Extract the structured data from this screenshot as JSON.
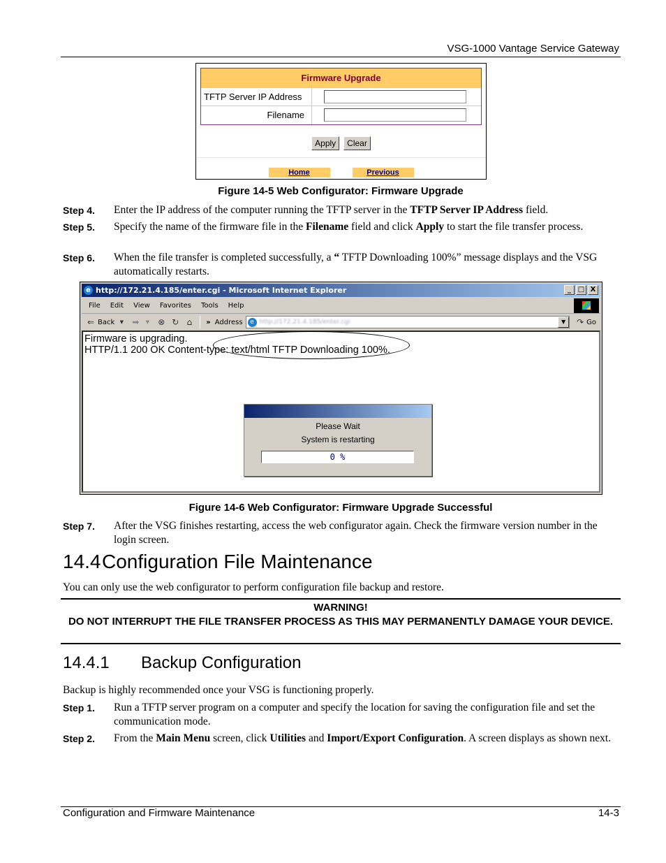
{
  "header": {
    "title": "VSG-1000 Vantage Service Gateway"
  },
  "figure5": {
    "caption": "Figure 14-5 Web Configurator: Firmware Upgrade",
    "form": {
      "title": "Firmware Upgrade",
      "fields": [
        {
          "label": "TFTP Server IP Address",
          "value": ""
        },
        {
          "label": "Filename",
          "value": ""
        }
      ],
      "buttons": {
        "apply": "Apply",
        "clear": "Clear"
      },
      "nav": {
        "home": "Home",
        "previous": "Previous"
      }
    },
    "colors": {
      "header_bg": "#ffcc66",
      "header_text": "#800040",
      "border": "#7a3a7a"
    }
  },
  "steps_a": [
    {
      "num": "Step 4.",
      "parts": [
        {
          "t": "Enter the IP address of the computer running the TFTP server in the "
        },
        {
          "t": "TFTP Server IP Address",
          "b": true
        },
        {
          "t": " field."
        }
      ]
    },
    {
      "num": "Step 5.",
      "parts": [
        {
          "t": "Specify the name of the firmware file in the "
        },
        {
          "t": "Filename",
          "b": true
        },
        {
          "t": " field and click "
        },
        {
          "t": "Apply",
          "b": true
        },
        {
          "t": " to start the file transfer process."
        }
      ]
    },
    {
      "num": "Step 6.",
      "parts": [
        {
          "t": "When the file transfer is completed successfully, a "
        },
        {
          "t": "“",
          "b": true
        },
        {
          "t": " TFTP Downloading 100%” message displays and the VSG automatically restarts."
        }
      ]
    }
  ],
  "figure6": {
    "caption": "Figure 14-6 Web Configurator: Firmware Upgrade Successful",
    "browser": {
      "title": "http://172.21.4.185/enter.cgi - Microsoft Internet Explorer",
      "window_controls": [
        "_",
        "□",
        "X"
      ],
      "menu": [
        "File",
        "Edit",
        "View",
        "Favorites",
        "Tools",
        "Help"
      ],
      "toolbar": {
        "back": "Back",
        "more": "»",
        "address_label": "Address",
        "address_value": "http://172.21.4.185/enter.cgi",
        "go": "Go"
      },
      "content_lines": [
        "Firmware is upgrading.",
        "HTTP/1.1 200 OK Content-type: text/html TFTP Downloading 100%."
      ],
      "dialog": {
        "line1": "Please Wait",
        "line2": "System is restarting",
        "progress_label": "0 %",
        "progress_percent": 0
      }
    }
  },
  "steps_b": [
    {
      "num": "Step 7.",
      "parts": [
        {
          "t": "After the VSG finishes restarting, access the web configurator again. Check the firmware version number in the login screen."
        }
      ]
    }
  ],
  "section": {
    "number": "14.4",
    "title": "Configuration File Maintenance",
    "intro": "You can only use the web configurator to perform configuration file backup and restore.",
    "warning": {
      "title": "WARNING!",
      "text": "DO NOT INTERRUPT THE FILE TRANSFER PROCESS AS THIS MAY PERMANENTLY DAMAGE YOUR DEVICE."
    }
  },
  "subsection": {
    "number": "14.4.1",
    "title": "Backup Configuration",
    "intro": "Backup is highly recommended once your VSG is functioning properly."
  },
  "steps_c": [
    {
      "num": "Step 1.",
      "parts": [
        {
          "t": "Run a TFTP server program on a computer and specify the location for saving the configuration file and set the communication mode."
        }
      ]
    },
    {
      "num": "Step 2.",
      "parts": [
        {
          "t": "From the "
        },
        {
          "t": "Main Menu",
          "b": true
        },
        {
          "t": " screen, click "
        },
        {
          "t": "Utilities",
          "b": true
        },
        {
          "t": " and "
        },
        {
          "t": "Import/Export Configuration",
          "b": true
        },
        {
          "t": ". A screen displays as shown next."
        }
      ]
    }
  ],
  "footer": {
    "left": "Configuration and Firmware Maintenance",
    "right": "14-3"
  }
}
